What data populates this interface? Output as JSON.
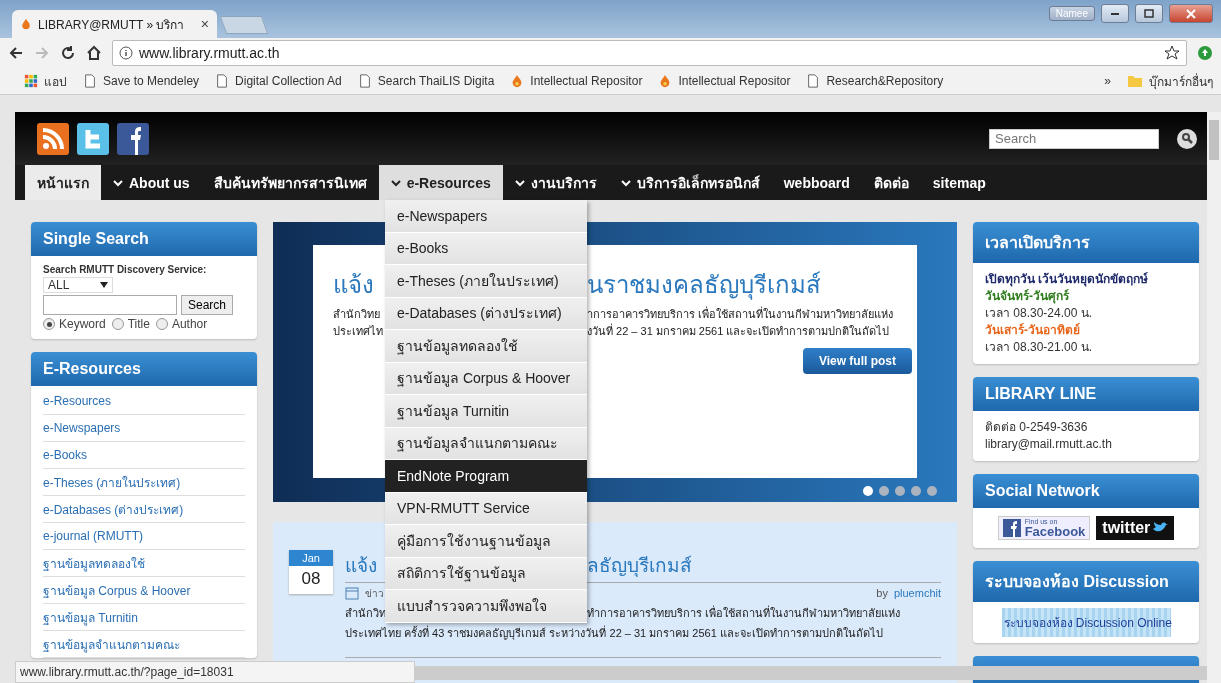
{
  "browser": {
    "tab": {
      "title": "LIBRARY@RMUTT » บริกา",
      "close": "×"
    },
    "profile": "Namee",
    "url": "www.library.rmutt.ac.th",
    "bookmarks": [
      {
        "label": "แอป",
        "kind": "apps"
      },
      {
        "label": "Save to Mendeley",
        "kind": "page"
      },
      {
        "label": "Digital Collection Ad",
        "kind": "page"
      },
      {
        "label": "Search ThaiLIS Digita",
        "kind": "page"
      },
      {
        "label": "Intellectual Repositor",
        "kind": "flame"
      },
      {
        "label": "Intellectual Repositor",
        "kind": "flame"
      },
      {
        "label": "Research&Repository",
        "kind": "page"
      }
    ],
    "more": "»",
    "other_bookmarks": "บุ๊กมาร์กอื่นๆ"
  },
  "header": {
    "search": {
      "placeholder": "Search"
    }
  },
  "nav": [
    {
      "label": "หน้าแรก",
      "selected": true,
      "open": false,
      "has_submenu": false
    },
    {
      "label": "About us",
      "selected": false,
      "open": false,
      "has_submenu": true
    },
    {
      "label": "สืบค้นทรัพยากรสารนิเทศ",
      "selected": false,
      "open": false,
      "has_submenu": false
    },
    {
      "label": "e-Resources",
      "selected": false,
      "open": true,
      "has_submenu": true
    },
    {
      "label": "งานบริการ",
      "selected": false,
      "open": false,
      "has_submenu": true
    },
    {
      "label": "บริการอิเล็กทรอนิกส์",
      "selected": false,
      "open": false,
      "has_submenu": true
    },
    {
      "label": "webboard",
      "selected": false,
      "open": false,
      "has_submenu": false
    },
    {
      "label": "ติดต่อ",
      "selected": false,
      "open": false,
      "has_submenu": false
    },
    {
      "label": "sitemap",
      "selected": false,
      "open": false,
      "has_submenu": false
    }
  ],
  "dropdown": [
    {
      "label": "e-Newspapers",
      "highlighted": false
    },
    {
      "label": "e-Books",
      "highlighted": false
    },
    {
      "label": "e-Theses (ภายในประเทศ)",
      "highlighted": false
    },
    {
      "label": "e-Databases (ต่างประเทศ)",
      "highlighted": false
    },
    {
      "label": "ฐานข้อมูลทดลองใช้",
      "highlighted": false
    },
    {
      "label": "ฐานข้อมูล Corpus & Hoover",
      "highlighted": false
    },
    {
      "label": "ฐานข้อมูล Turnitin",
      "highlighted": false
    },
    {
      "label": "ฐานข้อมูลจำแนกตามคณะ",
      "highlighted": false
    },
    {
      "label": "EndNote Program",
      "highlighted": true
    },
    {
      "label": "VPN-RMUTT Service",
      "highlighted": false
    },
    {
      "label": "คู่มือการใช้งานฐานข้อมูล",
      "highlighted": false
    },
    {
      "label": "สถิติการใช้ฐานข้อมูล",
      "highlighted": false
    },
    {
      "label": "แบบสำรวจความพึงพอใจ",
      "highlighted": false
    }
  ],
  "sidebar": {
    "single_search": {
      "title": "Single Search",
      "caption": "Search RMUTT Discovery Service:",
      "scope": "ALL",
      "button": "Search",
      "options": [
        {
          "label": "Keyword",
          "selected": true
        },
        {
          "label": "Title",
          "selected": false
        },
        {
          "label": "Author",
          "selected": false
        }
      ]
    },
    "eresources": {
      "title": "E-Resources",
      "items": [
        "e-Resources",
        "e-Newspapers",
        "e-Books",
        "e-Theses (ภายในประเทศ)",
        "e-Databases (ต่างประเทศ)",
        "e-journal (RMUTT)",
        "ฐานข้อมูลทดลองใช้",
        "ฐานข้อมูล Corpus & Hoover",
        "ฐานข้อมูล Turnitin",
        "ฐานข้อมูลจำแนกตามคณะ"
      ]
    }
  },
  "slider": {
    "title_parts": [
      "แจ้ง",
      "นราชมงคลธัญบุรีเกมส์"
    ],
    "lines": [
      [
        "สำนักวิทย",
        "าการอาคารวิทยบริการ เพื่อใช้สถานที่ในงานกีฬามหาวิทยาลัยแห่ง"
      ],
      [
        "ประเทศไท",
        "งวันที่ 22 – 31 มกราคม 2561   และจะเปิดทำการตามปกติในถัดไป"
      ]
    ],
    "button": "View full post",
    "dots": [
      {
        "selected": true
      },
      {
        "selected": false
      },
      {
        "selected": false
      },
      {
        "selected": false
      },
      {
        "selected": false
      }
    ]
  },
  "post": {
    "month": "Jan",
    "day": "08",
    "title_parts": [
      "แจ้ง",
      "ลธัญบุรีเกมส์"
    ],
    "category": "ข่าว",
    "by": "by",
    "author": "pluemchit",
    "lines": [
      [
        "สำนักวิท",
        "ทำการอาคารวิทยบริการ เพื่อใช้สถานที่ในงานกีฬามหาวิทยาลัยแห่ง"
      ],
      [
        "ประเทศไทย ครั้งที่ 43 ราชมงคลธัญบุรีเกมส์ ระหว่างวันที่ 22 – 31 มกราคม 2561   และจะเปิดทำการตามปกติในถัดไป"
      ]
    ]
  },
  "right": {
    "hours": {
      "title": "เวลาเปิดบริการ",
      "lines": [
        {
          "text": "เปิดทุกวัน เว้นวันหยุดนักขัตฤกษ์",
          "color": "#1f2a6b"
        },
        {
          "text": "วันจันทร์-วันศุกร์",
          "color": "#2f7d1e"
        },
        {
          "text": "เวลา 08.30-24.00 น.",
          "color": "#333333"
        },
        {
          "text": "วันเสาร์-วันอาทิตย์",
          "color": "#e8661c"
        },
        {
          "text": "เวลา 08.30-21.00 น.",
          "color": "#333333"
        }
      ]
    },
    "line": {
      "title": "LIBRARY LINE",
      "lines": [
        "ติดต่อ 0-2549-3636",
        "library@mail.rmutt.ac.th"
      ]
    },
    "social": {
      "title": "Social Network",
      "facebook_small": "Find us on",
      "facebook": "Facebook",
      "twitter": "twitter"
    },
    "discussion": {
      "title": "ระบบจองห้อง Discussion",
      "banner": "ระบบจองห้อง Discussion Online"
    }
  },
  "status_url": "www.library.rmutt.ac.th/?page_id=18031"
}
